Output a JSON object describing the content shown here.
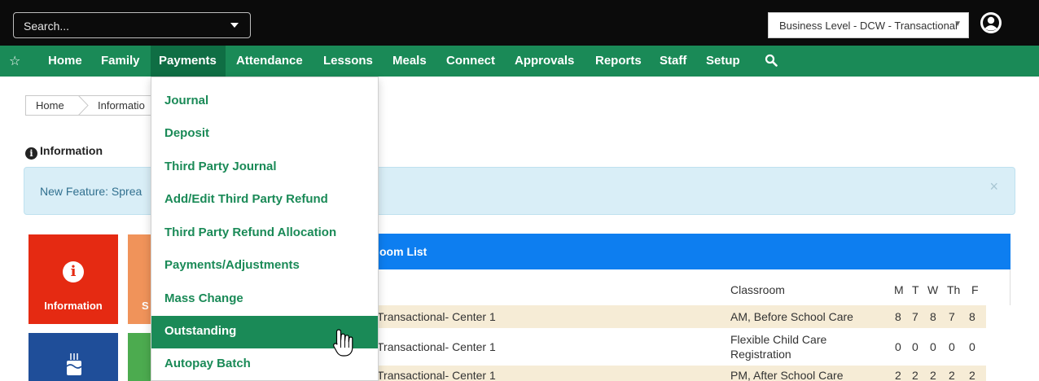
{
  "topbar": {
    "search_placeholder": "Search...",
    "business_select": "Business Level - DCW - Transactional"
  },
  "nav": {
    "items": [
      "Home",
      "Family",
      "Payments",
      "Attendance",
      "Lessons",
      "Meals",
      "Connect",
      "Approvals",
      "Reports",
      "Staff",
      "Setup"
    ],
    "active": "Payments"
  },
  "breadcrumb": [
    "Home",
    "Informatio"
  ],
  "info_heading": "Information",
  "alert": {
    "text": "New Feature: Sprea",
    "close": "×"
  },
  "tiles": {
    "info_label": "Information",
    "orange_label": "S"
  },
  "room_list": {
    "title": "oom List",
    "headers": {
      "classroom": "Classroom",
      "days": [
        "M",
        "T",
        "W",
        "Th",
        "F"
      ]
    },
    "rows": [
      {
        "name": "Transactional- Center 1",
        "classroom": "AM, Before School Care",
        "values": [
          "8",
          "7",
          "8",
          "7",
          "8"
        ]
      },
      {
        "name": "Transactional- Center 1",
        "classroom": "Flexible Child Care Registration",
        "values": [
          "0",
          "0",
          "0",
          "0",
          "0"
        ]
      },
      {
        "name": "Transactional- Center 1",
        "classroom": "PM, After School Care",
        "values": [
          "2",
          "2",
          "2",
          "2",
          "2"
        ]
      }
    ]
  },
  "payments_menu": [
    "Journal",
    "Deposit",
    "Third Party Journal",
    "Add/Edit Third Party Refund",
    "Third Party Refund Allocation",
    "Payments/Adjustments",
    "Mass Change",
    "Outstanding",
    "Autopay Batch"
  ],
  "payments_menu_active": "Outstanding",
  "colors": {
    "nav_green": "#1a8a57",
    "info_red": "#e52a12",
    "panel_blue": "#0d7ef0"
  }
}
